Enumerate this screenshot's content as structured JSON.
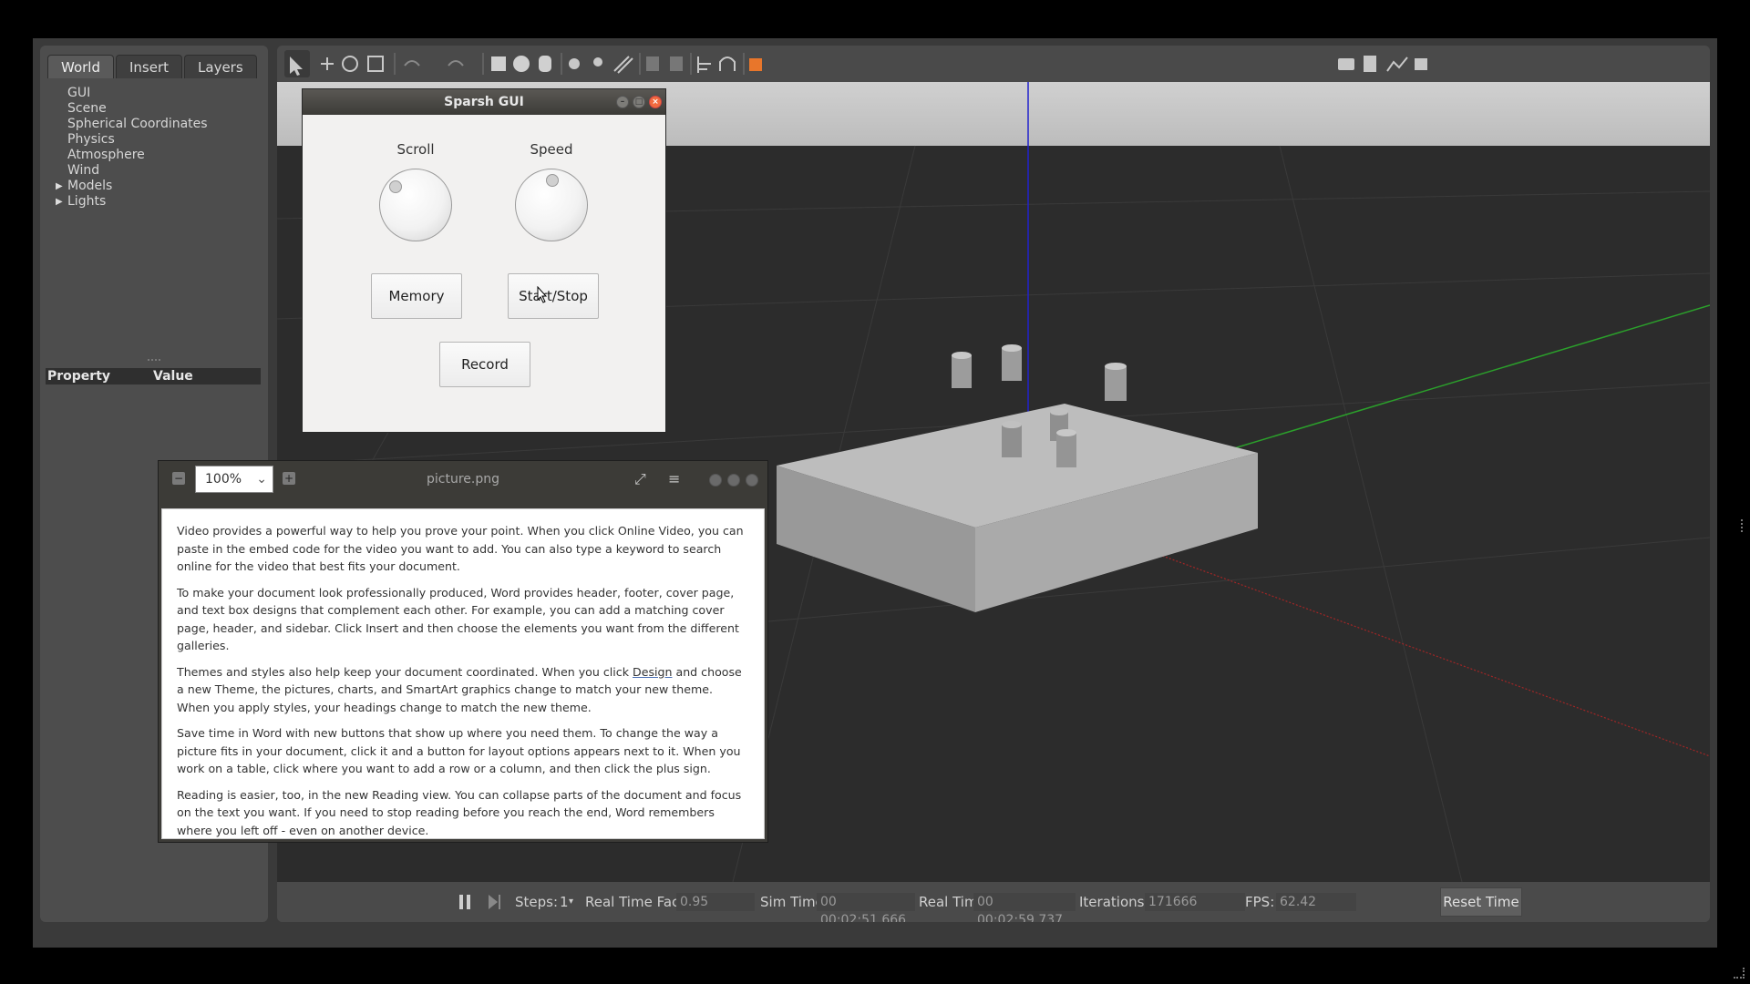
{
  "left_panel": {
    "tabs": [
      {
        "label": "World"
      },
      {
        "label": "Insert"
      },
      {
        "label": "Layers"
      }
    ],
    "world_items": [
      {
        "label": "GUI"
      },
      {
        "label": "Scene"
      },
      {
        "label": "Spherical Coordinates"
      },
      {
        "label": "Physics"
      },
      {
        "label": "Atmosphere"
      },
      {
        "label": "Wind"
      },
      {
        "label": "Models"
      },
      {
        "label": "Lights"
      }
    ],
    "property_header": {
      "property": "Property",
      "value": "Value"
    }
  },
  "toolbar": {
    "icons": [
      "select-arrow-icon",
      "translate-icon",
      "rotate-icon",
      "scale-icon",
      "undo-icon",
      "redo-icon",
      "box-icon",
      "sphere-icon",
      "cylinder-icon",
      "point-light-icon",
      "spot-light-icon",
      "directional-light-icon",
      "copy-icon",
      "paste-icon",
      "align-icon",
      "snap-icon",
      "view-angle-icon",
      "screenshot-icon",
      "log-icon",
      "plot-icon",
      "video-record-icon"
    ]
  },
  "sparsh_gui": {
    "title": "Sparsh GUI",
    "scroll_label": "Scroll",
    "speed_label": "Speed",
    "memory_label": "Memory",
    "start_stop_label": "Start/Stop",
    "record_label": "Record"
  },
  "viewer": {
    "zoom": "100%",
    "title": "picture.png",
    "paragraphs": {
      "p1": "Video provides a powerful way to help you prove your point. When you click Online Video, you can paste in the embed code for the video you want to add. You can also type a keyword to search online for the video that best fits your document.",
      "p2": "To make your document look professionally produced, Word provides header, footer, cover page, and text box designs that complement each other. For example, you can add a matching cover page, header, and sidebar. Click Insert and then choose the elements you want from the different galleries.",
      "p3_before": "Themes and styles also help keep your document coordinated. When you click ",
      "p3_link": "Design",
      "p3_after": " and choose a new Theme, the pictures, charts, and SmartArt graphics change to match your new theme. When you apply styles, your headings change to match the new theme.",
      "p4": "Save time in Word with new buttons that show up where you need them. To change the way a picture fits in your document, click it and a button for layout options appears next to it. When you work on a table, click where you want to add a row or a column, and then click the plus sign.",
      "p5": "Reading is easier, too, in the new Reading view. You can collapse parts of the document and focus on the text you want. If you need to stop reading before you reach the end, Word remembers where you left off - even on another device."
    }
  },
  "statusbar": {
    "steps_label": "Steps:",
    "steps_value": "1",
    "rtf_label": "Real Time Factor:",
    "rtf_value": "0.95",
    "sim_time_label": "Sim Time:",
    "sim_time_value": "00 00:02:51.666",
    "real_time_label": "Real Time:",
    "real_time_value": "00 00:02:59.737",
    "iterations_label": "Iterations:",
    "iterations_value": "171666",
    "fps_label": "FPS:",
    "fps_value": "62.42",
    "reset_label": "Reset Time"
  },
  "colors": {
    "grid_bg": "#2a2a2a",
    "sky": "#c8c8c8",
    "axis_x": "#b02020",
    "axis_y": "#20b020",
    "axis_z": "#2020c0",
    "close_button": "#f26a3f"
  }
}
